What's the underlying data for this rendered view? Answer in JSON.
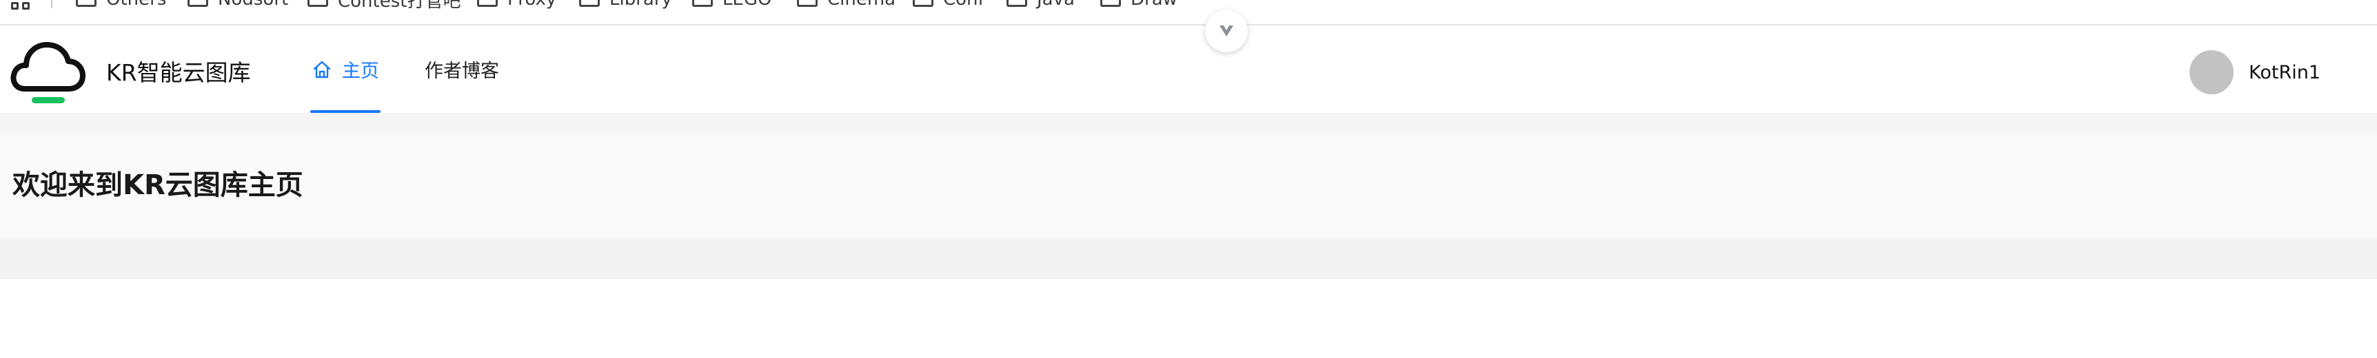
{
  "bookmarks_bar": {
    "items": [
      {
        "label": "Others"
      },
      {
        "label": "Nodsort"
      },
      {
        "label": "Contest打管吧"
      },
      {
        "label": "Proxy"
      },
      {
        "label": "Library"
      },
      {
        "label": "LEGO"
      },
      {
        "label": "Cinema"
      },
      {
        "label": "Conf"
      },
      {
        "label": "Java"
      },
      {
        "label": "Draw"
      }
    ]
  },
  "header": {
    "site_title": "KR智能云图库",
    "nav": {
      "home": "主页",
      "blog": "作者博客"
    },
    "user": {
      "name": "KotRin1"
    }
  },
  "main": {
    "welcome_title": "欢迎来到KR云图库主页"
  },
  "colors": {
    "accent": "#1677ff",
    "logo_bar": "#19c05f",
    "avatar": "#c2c2c2"
  }
}
